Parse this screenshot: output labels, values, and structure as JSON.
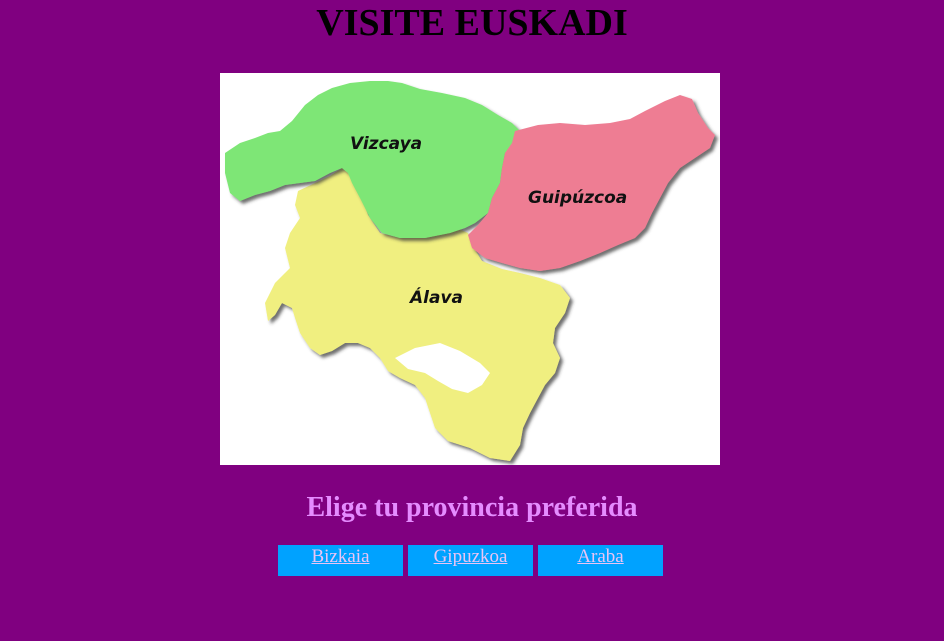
{
  "page": {
    "title": "VISITE EUSKADI",
    "subtitle": "Elige tu provincia preferida"
  },
  "map": {
    "labels": {
      "vizcaya": "Vizcaya",
      "guipuzcoa": "Guipúzcoa",
      "alava": "Álava"
    },
    "colors": {
      "vizcaya": "#7ee676",
      "guipuzcoa": "#ee7d93",
      "alava": "#f0ef80",
      "background": "#ffffff"
    }
  },
  "nav": {
    "items": [
      {
        "label": "Bizkaia"
      },
      {
        "label": "Gipuzkoa"
      },
      {
        "label": "Araba"
      }
    ]
  },
  "colors": {
    "page_background": "#800080",
    "subtitle": "#e58cff",
    "button_background": "#00a2ff",
    "link": "#e9c4f5"
  }
}
